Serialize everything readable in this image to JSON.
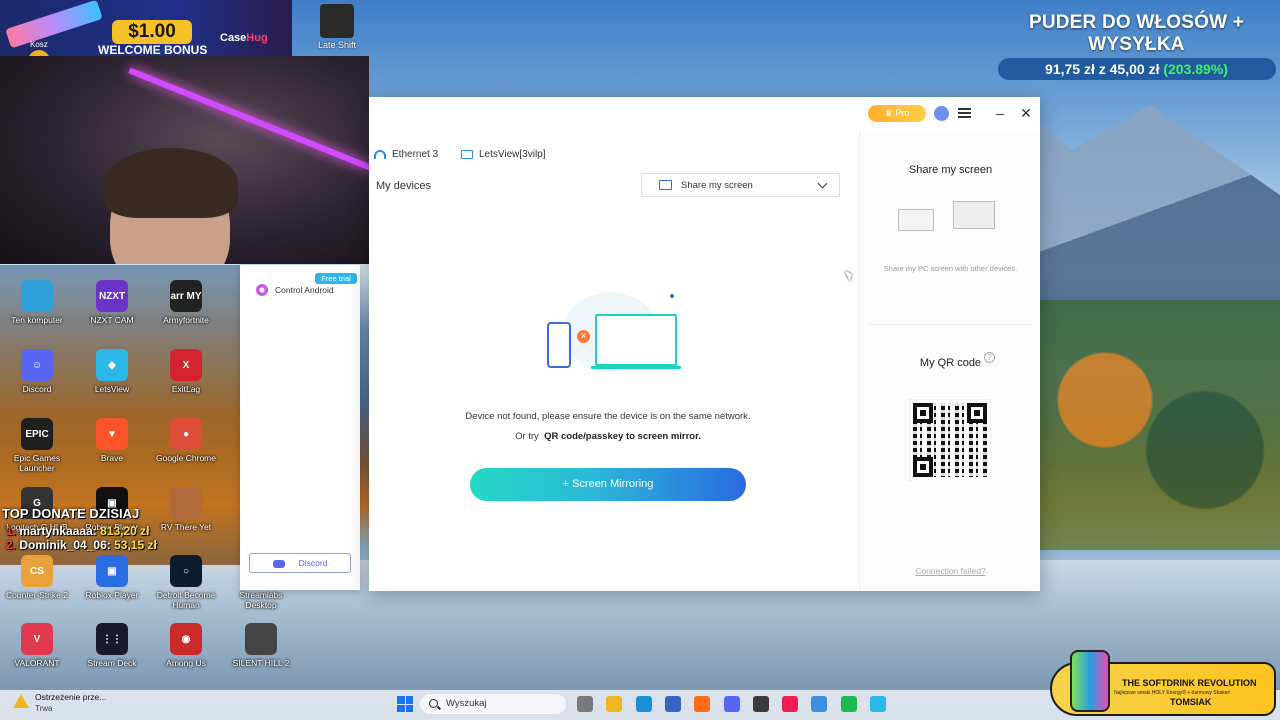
{
  "banner": {
    "amount": "$1.00",
    "bonus": "WELCOME BONUS",
    "brand_prefix": "Case",
    "brand_suffix": "Hug",
    "left_label": "Kosz"
  },
  "top_icons": [
    {
      "label": "Late Shift",
      "icon": "late-shift-icon",
      "color": "#2a2a2a"
    }
  ],
  "promo": {
    "title": "PUDER DO WŁOSÓW + WYSYŁKA",
    "price": "91,75 zł",
    "z": "z",
    "old_price": "45,00 zł",
    "percent": "(203.89%)"
  },
  "desktop_icons": [
    {
      "label": "Ten komputer",
      "icon": "computer-icon",
      "color": "#2f9fd8",
      "glyph": ""
    },
    {
      "label": "NZXT CAM",
      "icon": "nzxt-cam-icon",
      "color": "#6a35c7",
      "glyph": "NZXT"
    },
    {
      "label": "Armyfortnite",
      "icon": "army-icon",
      "color": "#222222",
      "glyph": "arr MY"
    },
    {
      "label": "Discord",
      "icon": "discord-icon",
      "color": "#5865f2",
      "glyph": "☺"
    },
    {
      "label": "LetsView",
      "icon": "letsview-icon",
      "color": "#2bb8e8",
      "glyph": "◆"
    },
    {
      "label": "ExitLag",
      "icon": "exitlag-icon",
      "color": "#d3232e",
      "glyph": "X"
    },
    {
      "label": "Epic Games Launcher",
      "icon": "epic-games-icon",
      "color": "#1f1f1f",
      "glyph": "EPIC"
    },
    {
      "label": "Brave",
      "icon": "brave-icon",
      "color": "#fb542b",
      "glyph": "▼"
    },
    {
      "label": "Google Chrome",
      "icon": "chrome-icon",
      "color": "#dd4b39",
      "glyph": "●"
    },
    {
      "label": "Logitech G HUB",
      "icon": "logitech-icon",
      "color": "#333333",
      "glyph": "G"
    },
    {
      "label": "Roblox Player",
      "icon": "roblox-studio-icon",
      "color": "#111111",
      "glyph": "▣"
    },
    {
      "label": "RV There Yet",
      "icon": "rv-there-yet-icon",
      "color": "#b36a3a",
      "glyph": ""
    },
    {
      "label": "Counter-Strike 2",
      "icon": "counter-strike-icon",
      "color": "#e9a23b",
      "glyph": "CS"
    },
    {
      "label": "Roblox Player",
      "icon": "roblox-player-icon",
      "color": "#2a6de0",
      "glyph": "▣"
    },
    {
      "label": "Detroit Become Human",
      "icon": "detroit-icon",
      "color": "#0d1c2c",
      "glyph": "○"
    },
    {
      "label": "Streamlabs Desktop",
      "icon": "streamlabs-icon",
      "color": "#31c3a2",
      "glyph": ""
    },
    {
      "label": "VALORANT",
      "icon": "valorant-icon",
      "color": "#e0394f",
      "glyph": "V"
    },
    {
      "label": "Stream Deck",
      "icon": "stream-deck-icon",
      "color": "#1a1a2e",
      "glyph": "⋮⋮"
    },
    {
      "label": "Among Us",
      "icon": "among-us-icon",
      "color": "#c92a2a",
      "glyph": "◉"
    },
    {
      "label": "SILENT HILL 2",
      "icon": "silent-hill-icon",
      "color": "#444444",
      "glyph": ""
    }
  ],
  "donate": {
    "heading": "TOP DONATE DZISIAJ",
    "rows": [
      {
        "rank": "1.",
        "name": "martynkaaaa:",
        "amount": "813,20 zł"
      },
      {
        "rank": "2.",
        "name": "Dominik_04_06:",
        "amount": "53,15 zł"
      }
    ]
  },
  "app": {
    "pro_label": "Pro",
    "networks": [
      {
        "label": "Ethernet 3",
        "icon": "wifi-icon"
      },
      {
        "label": "LetsView[3vilp]",
        "icon": "monitor-icon"
      }
    ],
    "my_devices": "My devices",
    "share_dropdown": "Share my screen",
    "not_found": "Device not found, please ensure the device is on the same network.",
    "or_try": "Or try",
    "qr_link": "QR code/passkey to screen mirror.",
    "mirror_button": "+ Screen Mirroring",
    "right": {
      "share_title": "Share my screen",
      "share_sub": "Share my PC screen with other devices.",
      "qr_title": "My QR code",
      "connection_failed": "Connection failed?"
    }
  },
  "side_panel": {
    "free_trial": "Free trial",
    "control_android": "Control Android",
    "discord": "Discord"
  },
  "taskbar": {
    "warning_title": "Ostrzeżenie prze...",
    "warning_sub": "Trwa",
    "search_placeholder": "Wyszukaj",
    "apps": [
      {
        "icon": "task-view-icon",
        "color": "#7a7a7a"
      },
      {
        "icon": "file-explorer-icon",
        "color": "#f2b625"
      },
      {
        "icon": "edge-icon",
        "color": "#1b8fd6"
      },
      {
        "icon": "store-icon",
        "color": "#3a63c9"
      },
      {
        "icon": "firefox-icon",
        "color": "#ff6a16"
      },
      {
        "icon": "discord-taskbar-icon",
        "color": "#5865f2"
      },
      {
        "icon": "obs-icon",
        "color": "#3a3a3a"
      },
      {
        "icon": "tiktok-icon",
        "color": "#ee1d52"
      },
      {
        "icon": "notepad-icon",
        "color": "#3b8de0"
      },
      {
        "icon": "spotify-icon",
        "color": "#1db954"
      },
      {
        "icon": "letsview-taskbar-icon",
        "color": "#2bb8e8"
      }
    ]
  },
  "softdrink": {
    "title": "THE SOFTDRINK REVOLUTION",
    "subtitle": "Najlepsze smaki HOLY Energy® + darmowy Shaker!",
    "code": "TOMSIAK"
  }
}
